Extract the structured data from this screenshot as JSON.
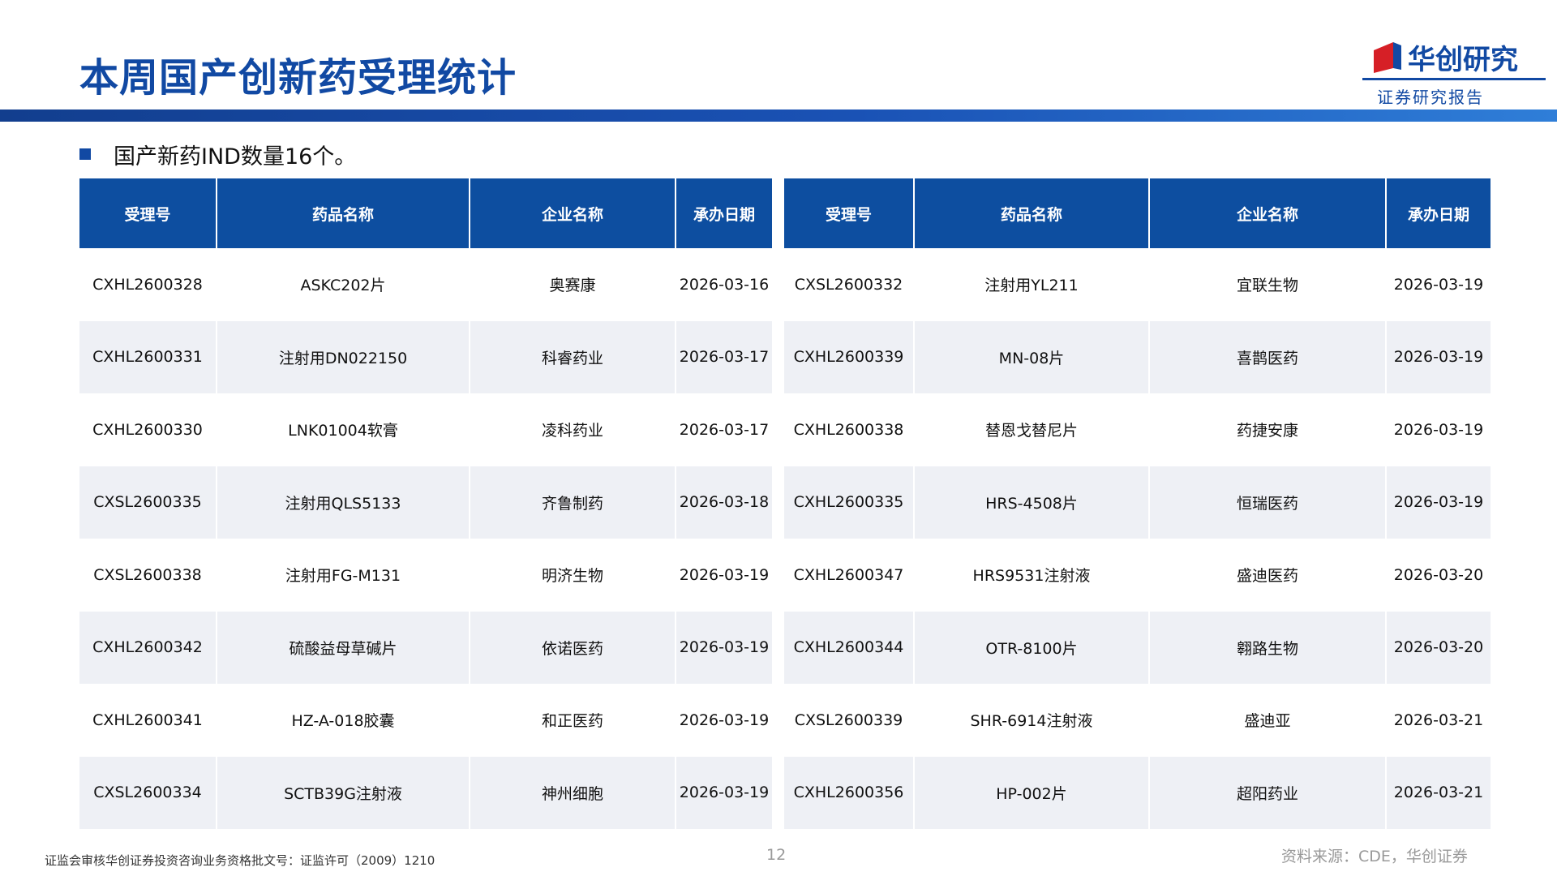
{
  "header": {
    "title": "本周国产创新药受理统计",
    "logo_name": "华创研究",
    "logo_sub": "证券研究报告"
  },
  "summary": {
    "bullet": "国产新药IND数量16个。"
  },
  "table": {
    "headers": [
      "受理号",
      "药品名称",
      "企业名称",
      "承办日期"
    ],
    "left_rows": [
      [
        "CXHL2600328",
        "ASKC202片",
        "奥赛康",
        "2026-03-16"
      ],
      [
        "CXHL2600331",
        "注射用DN022150",
        "科睿药业",
        "2026-03-17"
      ],
      [
        "CXHL2600330",
        "LNK01004软膏",
        "凌科药业",
        "2026-03-17"
      ],
      [
        "CXSL2600335",
        "注射用QLS5133",
        "齐鲁制药",
        "2026-03-18"
      ],
      [
        "CXSL2600338",
        "注射用FG-M131",
        "明济生物",
        "2026-03-19"
      ],
      [
        "CXHL2600342",
        "硫酸益母草碱片",
        "依诺医药",
        "2026-03-19"
      ],
      [
        "CXHL2600341",
        "HZ-A-018胶囊",
        "和正医药",
        "2026-03-19"
      ],
      [
        "CXSL2600334",
        "SCTB39G注射液",
        "神州细胞",
        "2026-03-19"
      ]
    ],
    "right_rows": [
      [
        "CXSL2600332",
        "注射用YL211",
        "宜联生物",
        "2026-03-19"
      ],
      [
        "CXHL2600339",
        "MN-08片",
        "喜鹊医药",
        "2026-03-19"
      ],
      [
        "CXHL2600338",
        "替恩戈替尼片",
        "药捷安康",
        "2026-03-19"
      ],
      [
        "CXHL2600335",
        "HRS-4508片",
        "恒瑞医药",
        "2026-03-19"
      ],
      [
        "CXHL2600347",
        "HRS9531注射液",
        "盛迪医药",
        "2026-03-20"
      ],
      [
        "CXHL2600344",
        "OTR-8100片",
        "翱路生物",
        "2026-03-20"
      ],
      [
        "CXSL2600339",
        "SHR-6914注射液",
        "盛迪亚",
        "2026-03-21"
      ],
      [
        "CXHL2600356",
        "HP-002片",
        "超阳药业",
        "2026-03-21"
      ]
    ]
  },
  "footer": {
    "license": "证监会审核华创证券投资咨询业务资格批文号：证监许可（2009）1210",
    "page": "12",
    "source": "资料来源：CDE，华创证券"
  },
  "colors": {
    "brand_blue": "#1149a3",
    "header_fill": "#0d4ea0",
    "stripe": "#eef0f5"
  }
}
